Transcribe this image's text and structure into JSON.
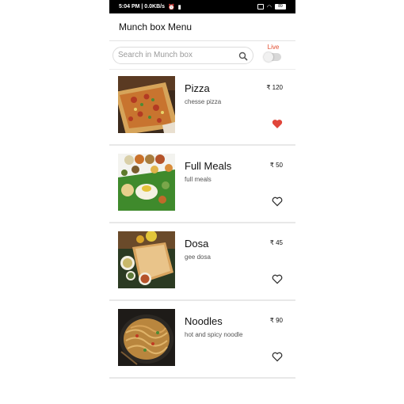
{
  "status_bar": {
    "time_info": "5:04 PM | 0.0KB/s",
    "battery": "89"
  },
  "app_bar": {
    "title": "Munch box Menu"
  },
  "search": {
    "placeholder": "Search in Munch box"
  },
  "live_toggle": {
    "label": "Live",
    "enabled": false
  },
  "colors": {
    "accent": "#e24b2d",
    "favorite": "#e0453a"
  },
  "menu_items": [
    {
      "name": "Pizza",
      "description": "chesse pizza",
      "price": "₹ 120",
      "favorite": true
    },
    {
      "name": "Full Meals",
      "description": "full meals",
      "price": "₹ 50",
      "favorite": false
    },
    {
      "name": "Dosa",
      "description": "gee dosa",
      "price": "₹ 45",
      "favorite": false
    },
    {
      "name": "Noodles",
      "description": "hot and spicy noodle",
      "price": "₹ 90",
      "favorite": false
    }
  ]
}
